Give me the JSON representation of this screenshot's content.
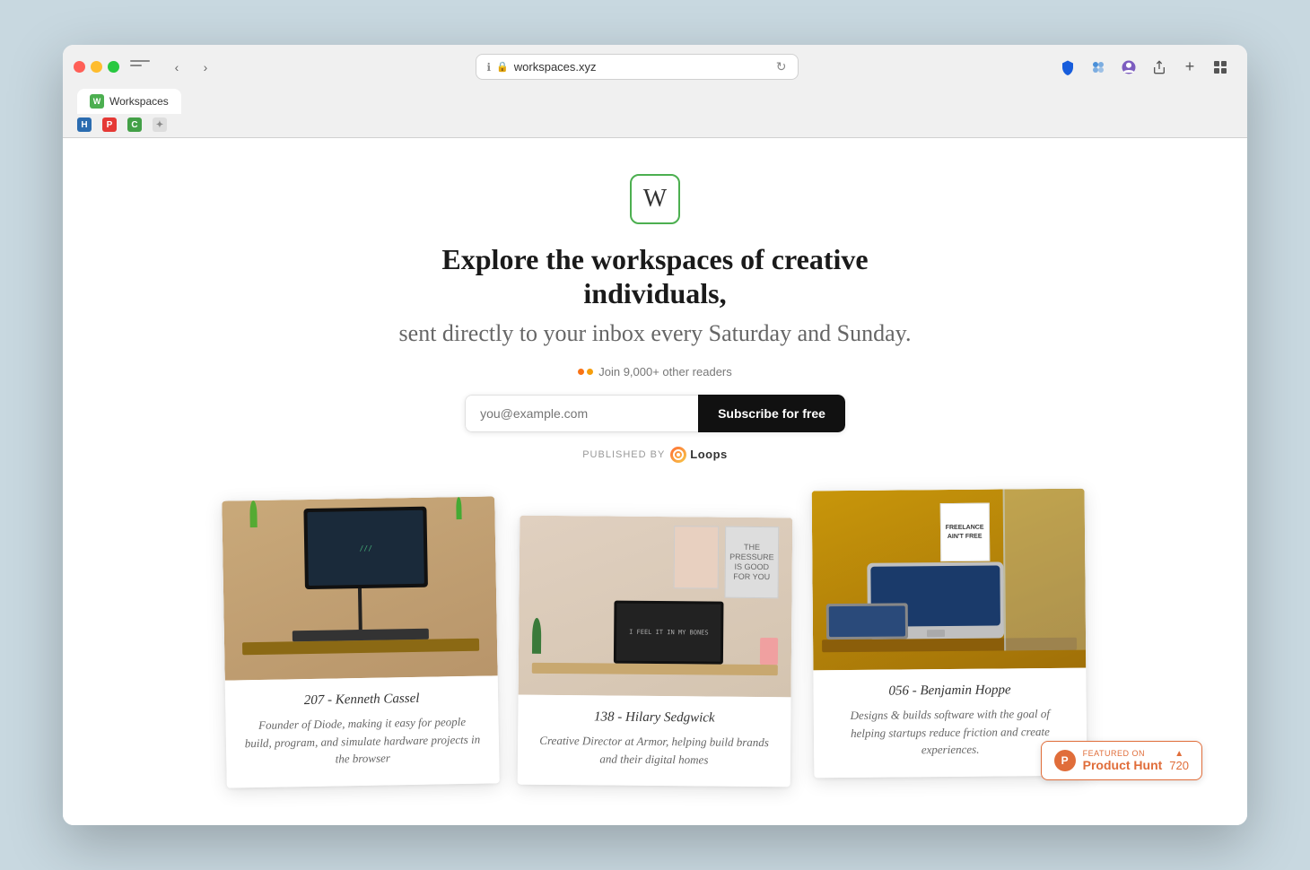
{
  "browser": {
    "url": "workspaces.xyz",
    "tab_title": "Workspaces",
    "tab_favicon_letter": "W",
    "info_icon": "ℹ",
    "reload_icon": "↻",
    "back_arrow": "‹",
    "forward_arrow": "›",
    "sidebar_toggle_icon": "sidebar-toggle-icon",
    "toolbar_icons": [
      "shield-icon",
      "extension-icon",
      "profile-icon",
      "share-icon",
      "add-tab-icon",
      "grid-icon"
    ]
  },
  "bookmarks": [
    {
      "label": "H",
      "color": "#e53935",
      "name": "h-bookmark"
    },
    {
      "label": "p",
      "color": "#e53935",
      "name": "pocket-bookmark"
    },
    {
      "label": "c",
      "color": "#4caf50",
      "name": "cloud-bookmark"
    },
    {
      "label": "✦",
      "color": "#aaa",
      "name": "star-bookmark"
    }
  ],
  "page": {
    "logo_letter": "W",
    "hero_title": "Explore the workspaces of creative individuals,",
    "hero_subtitle": "sent directly to your inbox every Saturday and Sunday.",
    "readers_label": "Join 9,000+ other readers",
    "email_placeholder": "you@example.com",
    "subscribe_button": "Subscribe for free",
    "published_label": "PUBLISHED BY",
    "loops_brand": "Loops"
  },
  "cards": [
    {
      "number_title": "207 - Kenneth Cassel",
      "description": "Founder of Diode, making it easy for people build, program, and simulate hardware projects in the browser",
      "bg_color": "#c9a97a"
    },
    {
      "number_title": "138 - Hilary Sedgwick",
      "description": "Creative Director at Armor, helping build brands and their digital homes",
      "bg_color": "#e5d8cc"
    },
    {
      "number_title": "056 - Benjamin Hoppe",
      "description": "Designs & builds software with the goal of helping startups reduce friction and create experiences.",
      "bg_color": "#d4a450"
    }
  ],
  "product_hunt": {
    "featured_label": "FEATURED ON",
    "name": "Product Hunt",
    "votes": "720",
    "icon_letter": "P"
  },
  "dots": [
    {
      "color": "#f97316"
    },
    {
      "color": "#f59e0b"
    }
  ]
}
